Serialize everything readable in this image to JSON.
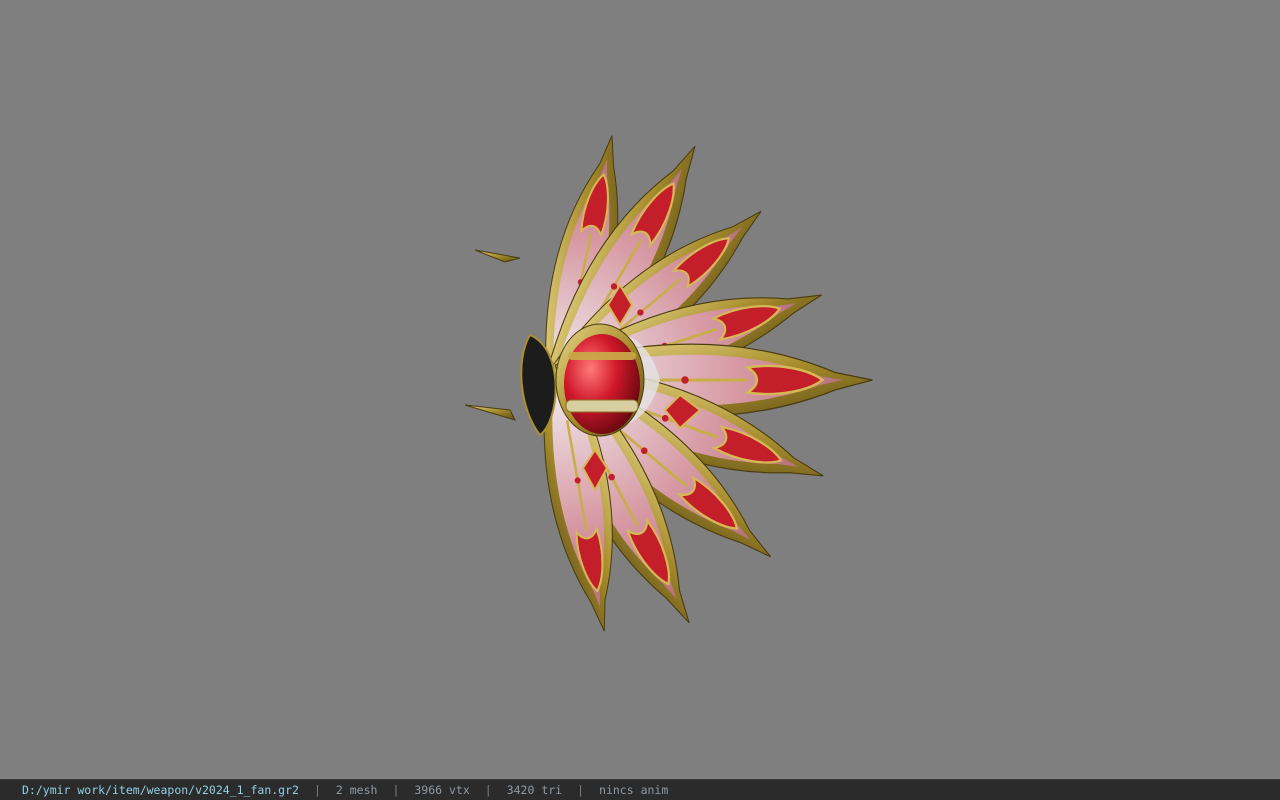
{
  "viewer": {
    "background_color": "#7f7f7f",
    "model_icon": "fan-weapon-model"
  },
  "status": {
    "file_path": "D:/ymir work/item/weapon/v2024_1_fan.gr2",
    "separator": "|",
    "mesh": "2 mesh",
    "vertices": "3966 vtx",
    "triangles": "3420 tri",
    "animation": "nincs anim"
  },
  "colors": {
    "statusbar_bg": "#2b2b2b",
    "path_text": "#8fd0e6",
    "info_text": "#8f9aa3",
    "gold": "#b09a3c",
    "red": "#c41e2a",
    "pink": "#d8a0a8"
  }
}
